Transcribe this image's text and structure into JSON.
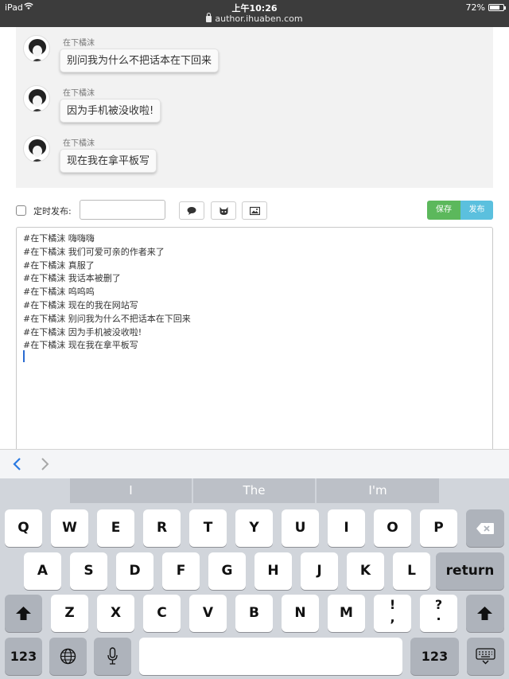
{
  "status_bar": {
    "device": "iPad",
    "time": "上午10:26",
    "url": "author.ihuaben.com",
    "battery_text": "72%",
    "battery_level": 0.72
  },
  "chat": {
    "messages": [
      {
        "name": "在下橘沫",
        "text": "别问我为什么不把话本在下回来"
      },
      {
        "name": "在下橘沫",
        "text": "因为手机被没收啦!"
      },
      {
        "name": "在下橘沫",
        "text": "现在我在拿平板写"
      }
    ]
  },
  "toolbar": {
    "schedule_label": "定时发布:",
    "schedule_value": "",
    "save_label": "保存",
    "publish_label": "发布"
  },
  "editor": {
    "lines": [
      "#在下橘沫 嗨嗨嗨",
      "#在下橘沫 我们可爱可亲的作者来了",
      "#在下橘沫 真服了",
      "#在下橘沫 我话本被删了",
      "#在下橘沫 呜呜呜",
      "#在下橘沫 现在的我在网站写",
      "#在下橘沫 别问我为什么不把话本在下回来",
      "#在下橘沫 因为手机被没收啦!",
      "#在下橘沫 现在我在拿平板写"
    ]
  },
  "keyboard": {
    "predictions": [
      "I",
      "The",
      "I'm"
    ],
    "row1": [
      "Q",
      "W",
      "E",
      "R",
      "T",
      "Y",
      "U",
      "I",
      "O",
      "P"
    ],
    "row2": [
      "A",
      "S",
      "D",
      "F",
      "G",
      "H",
      "J",
      "K",
      "L"
    ],
    "return_label": "return",
    "row3": [
      "Z",
      "X",
      "C",
      "V",
      "B",
      "N",
      "M"
    ],
    "punct1_top": "!",
    "punct1_bottom": ",",
    "punct2_top": "?",
    "punct2_bottom": ".",
    "numbers_label": "123"
  },
  "colors": {
    "save": "#5cb85c",
    "publish": "#5bc0de",
    "accent_blue": "#2a7ae2"
  }
}
